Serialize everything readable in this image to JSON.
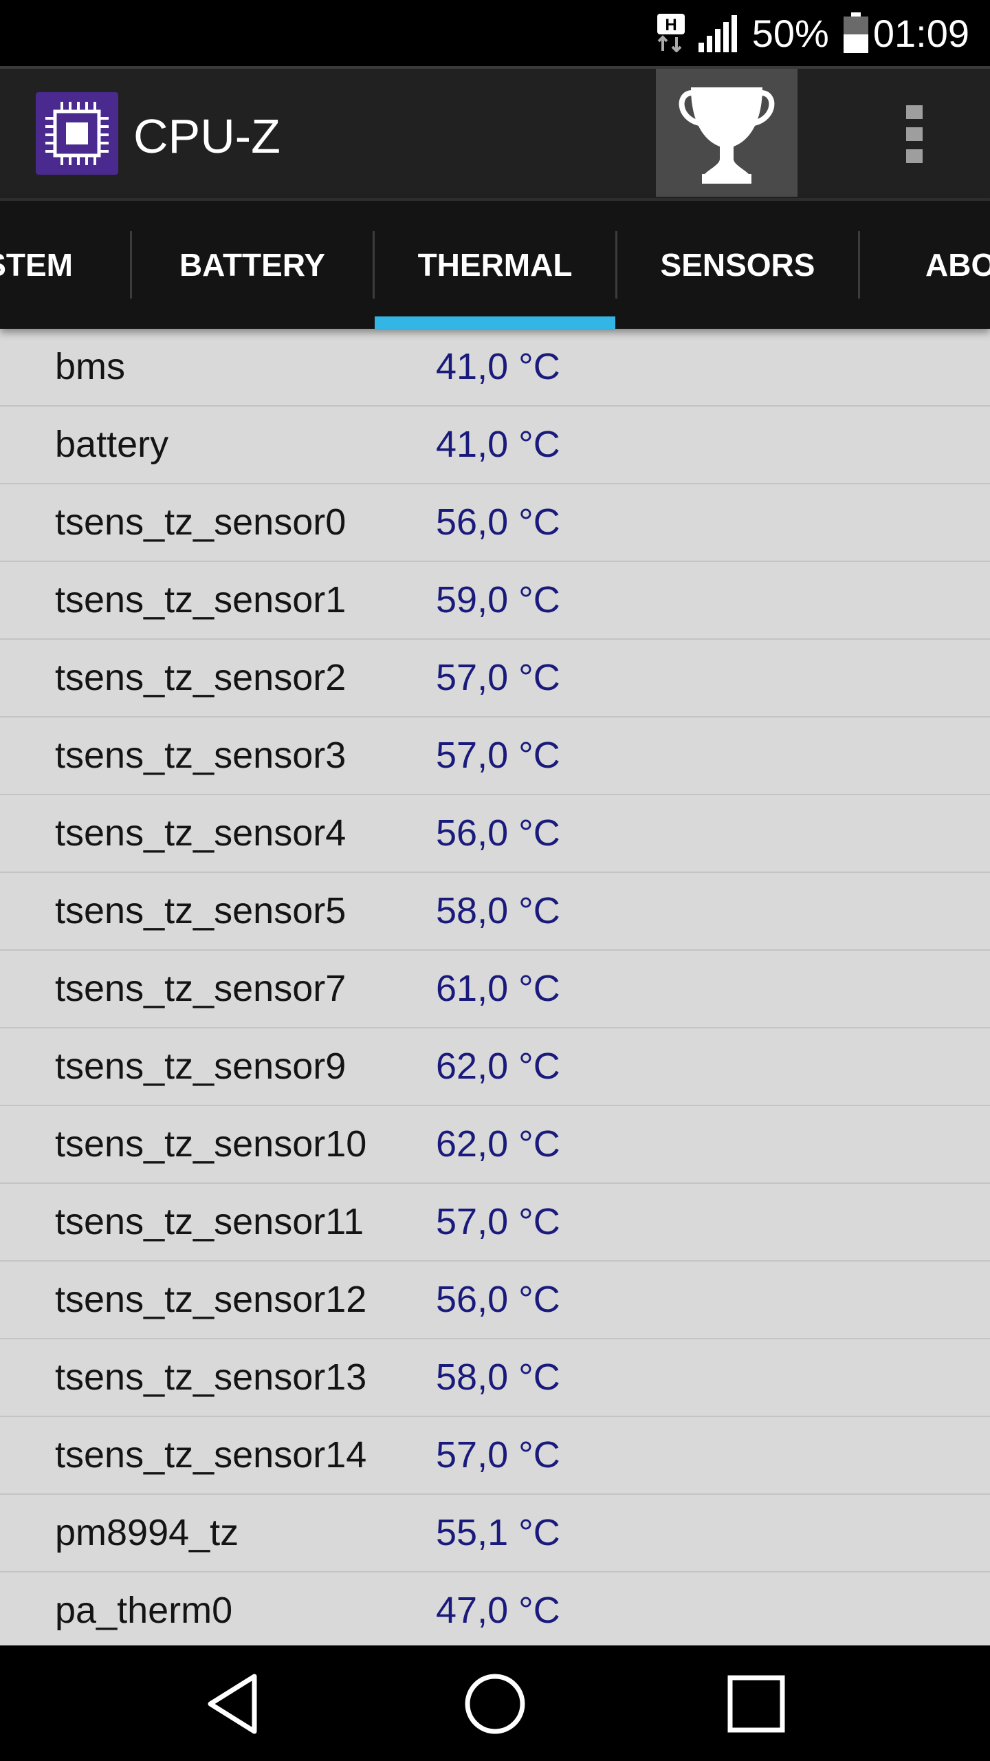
{
  "status_bar": {
    "network_type": "H",
    "battery_percent": "50%",
    "time": "01:09",
    "battery_level": 0.5,
    "icons": [
      "h-data-icon",
      "signal-icon",
      "battery-icon"
    ]
  },
  "app_bar": {
    "title": "CPU-Z",
    "icons": [
      "cpu-chip-icon",
      "trophy-icon",
      "overflow-menu-icon"
    ]
  },
  "tabs": [
    {
      "label": "STEM",
      "active": false
    },
    {
      "label": "BATTERY",
      "active": false
    },
    {
      "label": "THERMAL",
      "active": true
    },
    {
      "label": "SENSORS",
      "active": false
    },
    {
      "label": "ABO",
      "active": false
    }
  ],
  "thermal": [
    {
      "name": "bms",
      "value": "41,0 °C"
    },
    {
      "name": "battery",
      "value": "41,0 °C"
    },
    {
      "name": "tsens_tz_sensor0",
      "value": "56,0 °C"
    },
    {
      "name": "tsens_tz_sensor1",
      "value": "59,0 °C"
    },
    {
      "name": "tsens_tz_sensor2",
      "value": "57,0 °C"
    },
    {
      "name": "tsens_tz_sensor3",
      "value": "57,0 °C"
    },
    {
      "name": "tsens_tz_sensor4",
      "value": "56,0 °C"
    },
    {
      "name": "tsens_tz_sensor5",
      "value": "58,0 °C"
    },
    {
      "name": "tsens_tz_sensor7",
      "value": "61,0 °C"
    },
    {
      "name": "tsens_tz_sensor9",
      "value": "62,0 °C"
    },
    {
      "name": "tsens_tz_sensor10",
      "value": "62,0 °C"
    },
    {
      "name": "tsens_tz_sensor11",
      "value": "57,0 °C"
    },
    {
      "name": "tsens_tz_sensor12",
      "value": "56,0 °C"
    },
    {
      "name": "tsens_tz_sensor13",
      "value": "58,0 °C"
    },
    {
      "name": "tsens_tz_sensor14",
      "value": "57,0 °C"
    },
    {
      "name": "pm8994_tz",
      "value": "55,1 °C"
    },
    {
      "name": "pa_therm0",
      "value": "47,0 °C"
    }
  ],
  "nav_bar": {
    "icons": [
      "back-icon",
      "home-icon",
      "recents-icon"
    ]
  },
  "colors": {
    "tab_indicator": "#33b5e5",
    "value_text": "#1a1a7c",
    "list_background": "#d9d9d9",
    "app_icon": "#4a2a8f"
  }
}
